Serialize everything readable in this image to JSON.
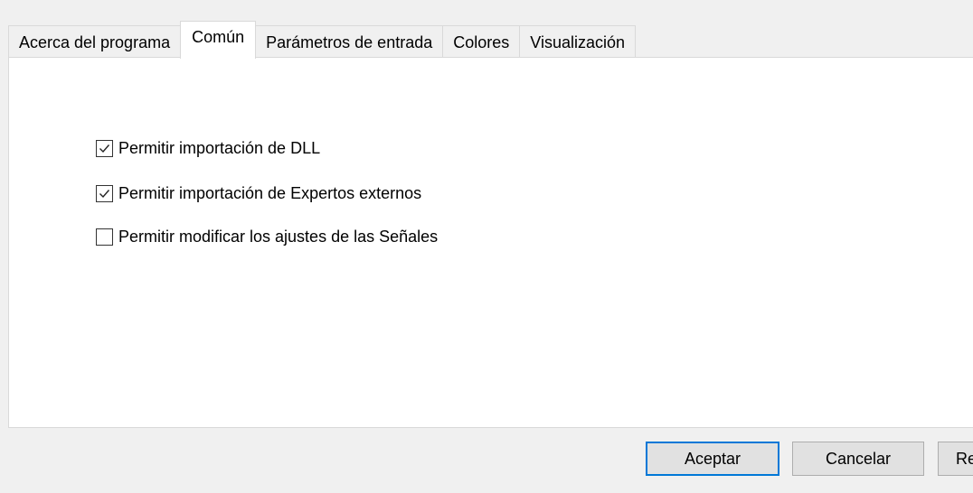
{
  "tabs": [
    {
      "label": "Acerca del programa",
      "active": false
    },
    {
      "label": "Común",
      "active": true
    },
    {
      "label": "Parámetros de entrada",
      "active": false
    },
    {
      "label": "Colores",
      "active": false
    },
    {
      "label": "Visualización",
      "active": false
    }
  ],
  "options": [
    {
      "label": "Permitir importación de DLL",
      "checked": true
    },
    {
      "label": "Permitir importación de Expertos externos",
      "checked": true
    },
    {
      "label": "Permitir modificar los ajustes de las Señales",
      "checked": false
    }
  ],
  "buttons": {
    "ok": "Aceptar",
    "cancel": "Cancelar",
    "reset": "Re"
  },
  "colors": {
    "default_button_border": "#0078d7",
    "panel_background": "#ffffff",
    "dialog_background": "#f0f0f0"
  }
}
